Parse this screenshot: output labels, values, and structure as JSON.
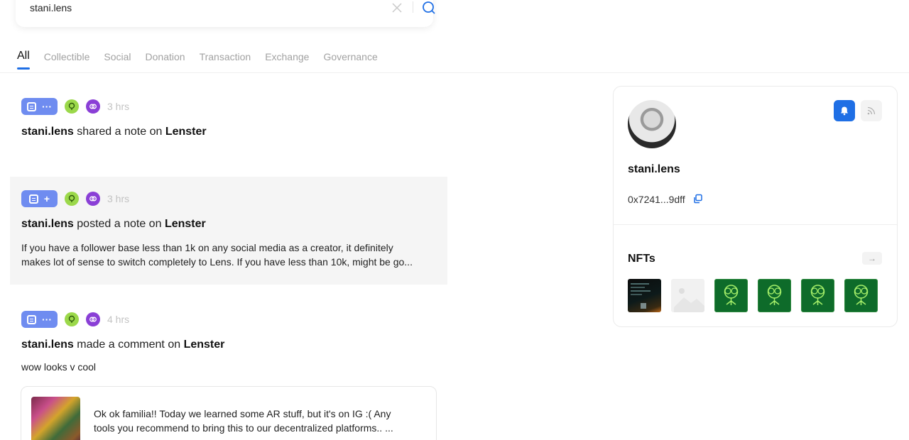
{
  "search": {
    "value": "stani.lens",
    "placeholder": ""
  },
  "tabs": [
    "All",
    "Collectible",
    "Social",
    "Donation",
    "Transaction",
    "Exchange",
    "Governance"
  ],
  "active_tab": "All",
  "feed": [
    {
      "time": "3 hrs",
      "user": "stani.lens",
      "action": "shared a note on",
      "platform": "Lenster",
      "text": ""
    },
    {
      "time": "3 hrs",
      "user": "stani.lens",
      "action": "posted a note on",
      "platform": "Lenster",
      "text_line1": "If you have a follower base less than 1k on any social media as a creator, it definitely",
      "text_line2": "makes lot of sense to switch completely to Lens. If you have less than 10k, might be go..."
    },
    {
      "time": "4 hrs",
      "user": "stani.lens",
      "action": "made a comment on",
      "platform": "Lenster",
      "text": "wow looks v cool",
      "quote_line1": "Ok ok familia!! Today we learned some AR stuff, but it's on IG :( Any",
      "quote_line2": "tools you recommend  to bring this to our decentralized platforms.. ..."
    }
  ],
  "profile": {
    "name": "stani.lens",
    "address": "0x7241...9dff",
    "nfts_title": "NFTs",
    "nfts_more": "→"
  },
  "colors": {
    "accent": "#1f6fe5",
    "tag": "#6f8cf0",
    "lenster": "#9bd84a",
    "lens": "#8a3fd6"
  }
}
